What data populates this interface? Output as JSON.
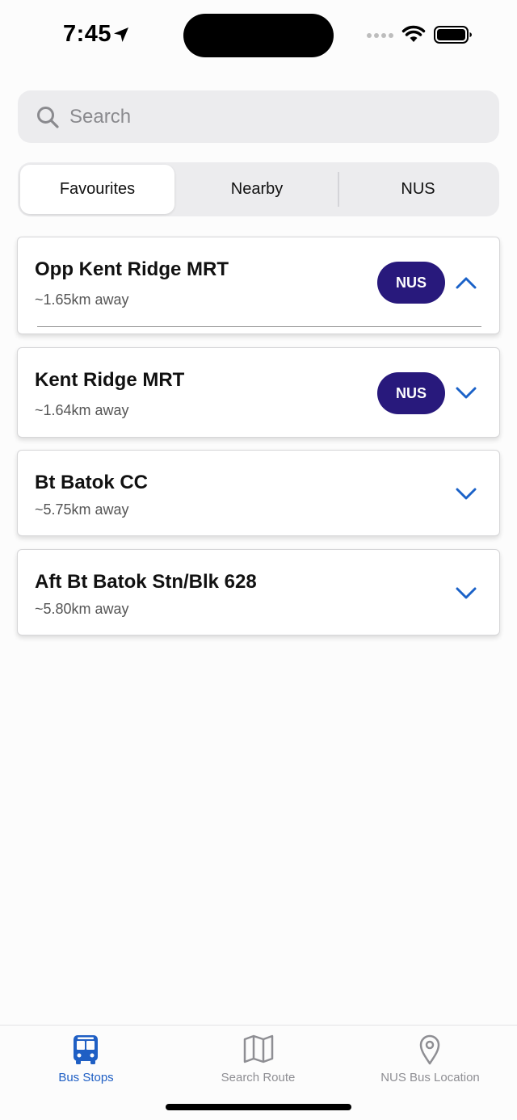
{
  "status_bar": {
    "time": "7:45"
  },
  "search": {
    "placeholder": "Search"
  },
  "segments": {
    "favourites": "Favourites",
    "nearby": "Nearby",
    "nus": "NUS",
    "selected": "Favourites"
  },
  "stops": [
    {
      "name": "Opp Kent Ridge MRT",
      "distance": "~1.65km away",
      "badge": "NUS",
      "expanded": true
    },
    {
      "name": "Kent Ridge MRT",
      "distance": "~1.64km away",
      "badge": "NUS",
      "expanded": false
    },
    {
      "name": "Bt Batok CC",
      "distance": "~5.75km away",
      "badge": "",
      "expanded": false
    },
    {
      "name": "Aft Bt Batok Stn/Blk 628",
      "distance": "~5.80km away",
      "badge": "",
      "expanded": false
    }
  ],
  "tabs": {
    "bus_stops": {
      "label": "Bus Stops",
      "icon": "bus-icon",
      "active": true
    },
    "search_route": {
      "label": "Search Route",
      "icon": "map-icon",
      "active": false
    },
    "nus_bus_location": {
      "label": "NUS Bus Location",
      "icon": "location-pin-icon",
      "active": false
    }
  },
  "colors": {
    "accent": "#1f5fc4",
    "nus_badge": "#28197c",
    "chevron": "#1b62c8",
    "inactive_tab": "#8e8e93"
  }
}
